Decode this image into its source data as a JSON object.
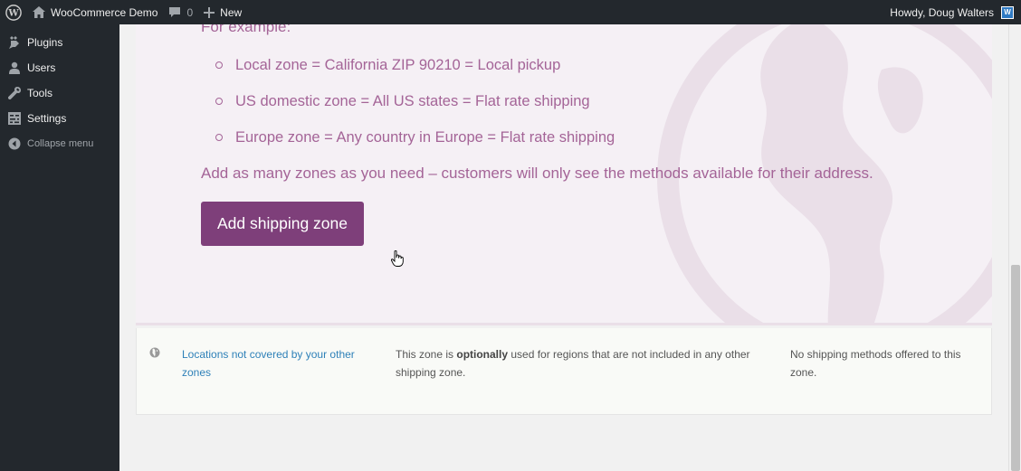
{
  "adminbar": {
    "site_name": "WooCommerce Demo",
    "comments_count": "0",
    "new_label": "New",
    "howdy": "Howdy, Doug Walters",
    "avatar_letter": "W"
  },
  "sidebar": {
    "items": [
      {
        "label": "Plugins",
        "icon": "plugin-icon"
      },
      {
        "label": "Users",
        "icon": "user-icon"
      },
      {
        "label": "Tools",
        "icon": "wrench-icon"
      },
      {
        "label": "Settings",
        "icon": "settings-icon"
      }
    ],
    "collapse_label": "Collapse menu"
  },
  "hero": {
    "example_label": "For example:",
    "zones": [
      "Local zone = California ZIP 90210 = Local pickup",
      "US domestic zone = All US states = Flat rate shipping",
      "Europe zone = Any country in Europe = Flat rate shipping"
    ],
    "note": "Add as many zones as you need – customers will only see the methods available for their address.",
    "button_label": "Add shipping zone"
  },
  "zone_row": {
    "link": "Locations not covered by your other zones",
    "desc_before": "This zone is ",
    "desc_bold": "optionally",
    "desc_after": " used for regions that are not included in any other shipping zone.",
    "methods": "No shipping methods offered to this zone."
  },
  "colors": {
    "accent": "#a46497",
    "button": "#7e3f7a",
    "link": "#2e80b8"
  }
}
